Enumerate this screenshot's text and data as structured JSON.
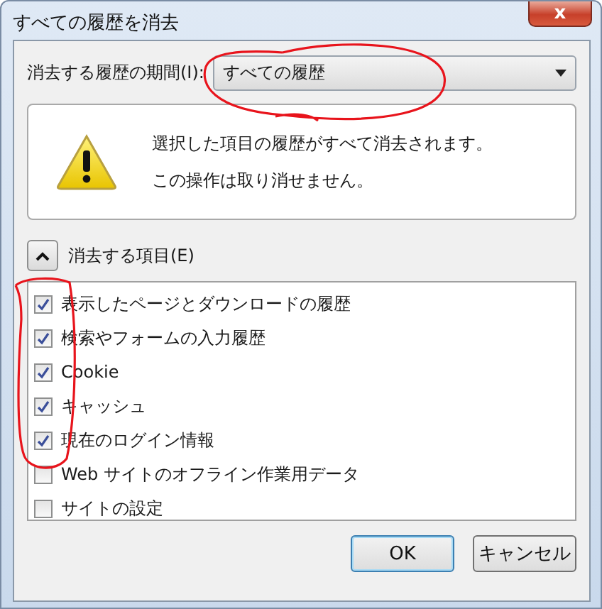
{
  "window": {
    "title": "すべての履歴を消去",
    "close": "x"
  },
  "range": {
    "label": "消去する履歴の期間(I):",
    "value": "すべての履歴"
  },
  "warning": {
    "lines": [
      "選択した項目の履歴がすべて消去されます。",
      "この操作は取り消せません。"
    ]
  },
  "details": {
    "label": "消去する項目(E)",
    "expanded": true
  },
  "items": [
    {
      "label": "表示したページとダウンロードの履歴",
      "checked": true
    },
    {
      "label": "検索やフォームの入力履歴",
      "checked": true
    },
    {
      "label": "Cookie",
      "checked": true
    },
    {
      "label": "キャッシュ",
      "checked": true
    },
    {
      "label": "現在のログイン情報",
      "checked": true
    },
    {
      "label": "Web サイトのオフライン作業用データ",
      "checked": false
    },
    {
      "label": "サイトの設定",
      "checked": false
    }
  ],
  "buttons": [
    {
      "label": "OK",
      "default": true
    },
    {
      "label": "キャンセル",
      "default": false
    }
  ]
}
